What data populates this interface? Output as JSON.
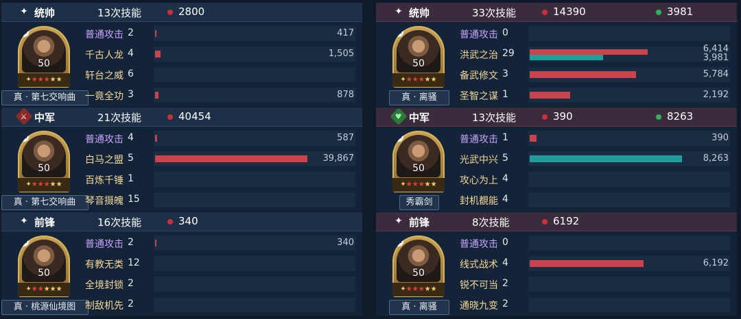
{
  "left": [
    {
      "header": {
        "icon": "sparkle-icon",
        "position": "统帅",
        "skill_count": "13次技能",
        "damage": "2800",
        "heal": ""
      },
      "hero": {
        "level": "50",
        "stars_red": 3,
        "stars_total": 5,
        "title": "真 · 第七交响曲"
      },
      "skills": [
        {
          "name": "普通攻击",
          "count": "2",
          "type": "normal",
          "damage": 417,
          "damage_label": "417",
          "heal": 0,
          "heal_label": ""
        },
        {
          "name": "千古人龙",
          "count": "4",
          "type": "skill",
          "damage": 1505,
          "damage_label": "1,505",
          "heal": 0,
          "heal_label": ""
        },
        {
          "name": "轩台之威",
          "count": "6",
          "type": "skill",
          "damage": 0,
          "damage_label": "",
          "heal": 0,
          "heal_label": ""
        },
        {
          "name": "一竟全功",
          "count": "3",
          "type": "skill",
          "damage": 878,
          "damage_label": "878",
          "heal": 0,
          "heal_label": ""
        }
      ]
    },
    {
      "header": {
        "icon": "sword-icon",
        "position": "中军",
        "skill_count": "21次技能",
        "damage": "40454",
        "heal": ""
      },
      "hero": {
        "level": "50",
        "stars_red": 3,
        "stars_total": 5,
        "title": "真 · 第七交响曲"
      },
      "skills": [
        {
          "name": "普通攻击",
          "count": "4",
          "type": "normal",
          "damage": 587,
          "damage_label": "587",
          "heal": 0,
          "heal_label": ""
        },
        {
          "name": "白马之盟",
          "count": "5",
          "type": "skill",
          "damage": 39867,
          "damage_label": "39,867",
          "heal": 0,
          "heal_label": ""
        },
        {
          "name": "百炼千锤",
          "count": "1",
          "type": "skill",
          "damage": 0,
          "damage_label": "",
          "heal": 0,
          "heal_label": ""
        },
        {
          "name": "琴音摄魄",
          "count": "15",
          "type": "skill",
          "damage": 0,
          "damage_label": "",
          "heal": 0,
          "heal_label": ""
        }
      ]
    },
    {
      "header": {
        "icon": "sparkle-icon",
        "position": "前锋",
        "skill_count": "16次技能",
        "damage": "340",
        "heal": ""
      },
      "hero": {
        "level": "50",
        "stars_red": 2,
        "stars_total": 5,
        "title": "真 · 桃源仙境图"
      },
      "skills": [
        {
          "name": "普通攻击",
          "count": "2",
          "type": "normal",
          "damage": 340,
          "damage_label": "340",
          "heal": 0,
          "heal_label": ""
        },
        {
          "name": "有教无类",
          "count": "12",
          "type": "skill",
          "damage": 0,
          "damage_label": "",
          "heal": 0,
          "heal_label": ""
        },
        {
          "name": "全境封锁",
          "count": "2",
          "type": "skill",
          "damage": 0,
          "damage_label": "",
          "heal": 0,
          "heal_label": ""
        },
        {
          "name": "制敌机先",
          "count": "2",
          "type": "skill",
          "damage": 0,
          "damage_label": "",
          "heal": 0,
          "heal_label": ""
        }
      ]
    }
  ],
  "right": [
    {
      "header": {
        "icon": "sparkle-icon",
        "position": "统帅",
        "skill_count": "33次技能",
        "damage": "14390",
        "heal": "3981"
      },
      "hero": {
        "level": "50",
        "stars_red": 3,
        "stars_total": 5,
        "title": "真 · 离骚"
      },
      "skills": [
        {
          "name": "普通攻击",
          "count": "0",
          "type": "normal",
          "damage": 0,
          "damage_label": "",
          "heal": 0,
          "heal_label": ""
        },
        {
          "name": "洪武之治",
          "count": "29",
          "type": "skill",
          "damage": 6414,
          "damage_label": "6,414",
          "heal": 3981,
          "heal_label": "3,981"
        },
        {
          "name": "备武修文",
          "count": "3",
          "type": "skill",
          "damage": 5784,
          "damage_label": "5,784",
          "heal": 0,
          "heal_label": ""
        },
        {
          "name": "圣智之谋",
          "count": "1",
          "type": "skill",
          "damage": 2192,
          "damage_label": "2,192",
          "heal": 0,
          "heal_label": ""
        }
      ]
    },
    {
      "header": {
        "icon": "heart-icon",
        "position": "中军",
        "skill_count": "13次技能",
        "damage": "390",
        "heal": "8263"
      },
      "hero": {
        "level": "50",
        "stars_red": 3,
        "stars_total": 5,
        "title": "秀霸剑"
      },
      "skills": [
        {
          "name": "普通攻击",
          "count": "1",
          "type": "normal",
          "damage": 390,
          "damage_label": "390",
          "heal": 0,
          "heal_label": ""
        },
        {
          "name": "光武中兴",
          "count": "5",
          "type": "skill",
          "damage": 0,
          "damage_label": "",
          "heal": 8263,
          "heal_label": "8,263"
        },
        {
          "name": "攻心为上",
          "count": "4",
          "type": "skill",
          "damage": 0,
          "damage_label": "",
          "heal": 0,
          "heal_label": ""
        },
        {
          "name": "封机覩能",
          "count": "4",
          "type": "skill",
          "damage": 0,
          "damage_label": "",
          "heal": 0,
          "heal_label": ""
        }
      ]
    },
    {
      "header": {
        "icon": "sparkle-icon",
        "position": "前锋",
        "skill_count": "8次技能",
        "damage": "6192",
        "heal": ""
      },
      "hero": {
        "level": "50",
        "stars_red": 3,
        "stars_total": 5,
        "title": "真 · 离骚"
      },
      "skills": [
        {
          "name": "普通攻击",
          "count": "0",
          "type": "normal",
          "damage": 0,
          "damage_label": "",
          "heal": 0,
          "heal_label": ""
        },
        {
          "name": "线式战术",
          "count": "4",
          "type": "skill",
          "damage": 6192,
          "damage_label": "6,192",
          "heal": 0,
          "heal_label": ""
        },
        {
          "name": "锐不可当",
          "count": "2",
          "type": "skill",
          "damage": 0,
          "damage_label": "",
          "heal": 0,
          "heal_label": ""
        },
        {
          "name": "通晓九变",
          "count": "2",
          "type": "skill",
          "damage": 0,
          "damage_label": "",
          "heal": 0,
          "heal_label": ""
        }
      ]
    }
  ],
  "scale": {
    "left_max": 39867,
    "right_max": 8263
  }
}
